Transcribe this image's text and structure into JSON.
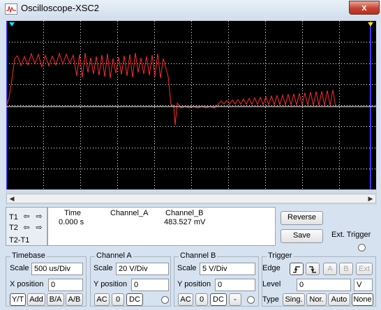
{
  "window": {
    "title": "Oscilloscope-XSC2",
    "close_symbol": "x"
  },
  "colors": {
    "trace": "#ff2020",
    "cursor": "#2a2aff",
    "grid": "#ffffff",
    "marker": "#00e5ff",
    "marker2": "#ffe000"
  },
  "readout": {
    "t1_label": "T1",
    "t2_label": "T2",
    "delta_label": "T2-T1",
    "col_time": "Time",
    "col_cha": "Channel_A",
    "col_chb": "Channel_B",
    "time_value": "0.000 s",
    "chb_value": "483.527 mV"
  },
  "buttons": {
    "reverse": "Reverse",
    "save": "Save",
    "ext_trigger": "Ext. Trigger"
  },
  "timebase": {
    "title": "Timebase",
    "scale_label": "Scale",
    "scale_value": "500 us/Div",
    "xpos_label": "X position",
    "xpos_value": "0",
    "modes": [
      "Y/T",
      "Add",
      "B/A",
      "A/B"
    ]
  },
  "channel_a": {
    "title": "Channel A",
    "scale_label": "Scale",
    "scale_value": "20  V/Div",
    "ypos_label": "Y position",
    "ypos_value": "0",
    "coupling": [
      "AC",
      "0",
      "DC"
    ]
  },
  "channel_b": {
    "title": "Channel B",
    "scale_label": "Scale",
    "scale_value": "5  V/Div",
    "ypos_label": "Y position",
    "ypos_value": "0",
    "coupling": [
      "AC",
      "0",
      "DC",
      "-"
    ]
  },
  "trigger": {
    "title": "Trigger",
    "edge_label": "Edge",
    "edge_options": [
      "A",
      "B",
      "Ext"
    ],
    "level_label": "Level",
    "level_value": "0",
    "level_unit": "V",
    "type_label": "Type",
    "types": [
      "Sing.",
      "Nor.",
      "Auto",
      "None"
    ]
  }
}
